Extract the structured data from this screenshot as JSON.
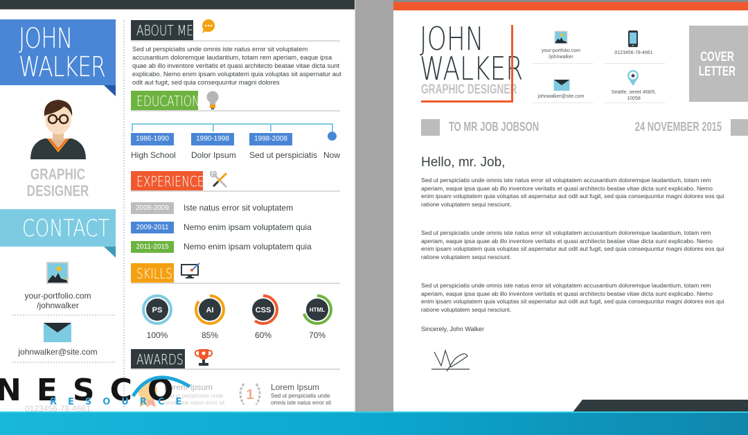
{
  "resume": {
    "name_line1": "JOHN",
    "name_line2": "WALKER",
    "role_line1": "GRAPHIC",
    "role_line2": "DESIGNER",
    "contact": {
      "title": "CONTACT",
      "portfolio_line1": "your-portfolio.com",
      "portfolio_line2": "/johnwalker",
      "email": "johnwalker@site.com",
      "phone": "0123456-78-4661"
    },
    "about": {
      "title": "ABOUT ME",
      "text": "Sed ut perspiciatis unde omnis iste natus error sit voluptatem accusantium doloremque laudantium, totam rem aperiam, eaque ipsa quae ab illo inventore veritatis et quasi architecto beatae vitae dicta sunt explicabo. Nemo enim ipsam voluptatem quia voluptas sit aspernatur aut odit aut fugit, sed quia consequuntur magni dolores"
    },
    "education": {
      "title": "EDUCATION",
      "items": [
        {
          "years": "1986-1990",
          "label": "High School"
        },
        {
          "years": "1990-1998",
          "label": "Dolor Ipsum"
        },
        {
          "years": "1998-2008",
          "label": "Sed ut perspiciatis"
        },
        {
          "years": "",
          "label": "Now"
        }
      ]
    },
    "experience": {
      "title": "EXPERIENCE",
      "items": [
        {
          "years": "2008-2009",
          "text": "Iste natus error sit voluptatem",
          "color": "#bdbdbd"
        },
        {
          "years": "2009-2011",
          "text": "Nemo enim ipsam voluptatem quia",
          "color": "#4a86d6"
        },
        {
          "years": "2011-2015",
          "text": "Nemo enim ipsam voluptatem quia",
          "color": "#6db33f"
        }
      ]
    },
    "skills": {
      "title": "SKILLS",
      "items": [
        {
          "name": "PS",
          "percent": 100,
          "pct_label": "100%",
          "color": "#7dcbe2"
        },
        {
          "name": "AI",
          "percent": 85,
          "pct_label": "85%",
          "color": "#f5a010"
        },
        {
          "name": "CSS",
          "percent": 60,
          "pct_label": "60%",
          "color": "#f0592e"
        },
        {
          "name": "HTML",
          "percent": 70,
          "pct_label": "70%",
          "color": "#6db33f"
        }
      ]
    },
    "awards": {
      "title": "AWARDS",
      "items": [
        {
          "title": "Lorem Ipsum",
          "line1": "Sed ut perspiciatis unde",
          "line2": "omnis iste natus error sit"
        },
        {
          "title": "Lorem Ipsum",
          "line1": "Sed ut perspiciatis unde",
          "line2": "omnis iste natus error sit",
          "badge": "1"
        }
      ]
    },
    "colors": {
      "blue": "#4a86d6",
      "teal": "#7dcbe2",
      "green": "#6db33f",
      "orange": "#f0592e",
      "amber": "#f5a010",
      "dark": "#303a3e"
    }
  },
  "letter": {
    "name_line1": "JOHN",
    "name_line2": "WALKER",
    "role": "GRAPHIC DESIGNER",
    "contact": {
      "portfolio_line1": "your-portfolio.com",
      "portfolio_line2": "/johnwalker",
      "phone": "0123456-78-4661",
      "email": "johnwalker@site.com",
      "address_line1": "Seattle, street 468/5,",
      "address_line2": "10058"
    },
    "cover_line1": "COVER",
    "cover_line2": "LETTER",
    "recipient": "TO MR JOB JOBSON",
    "date": "24 NOVEMBER 2015",
    "greeting": "Hello, mr. Job,",
    "paragraphs": [
      "Sed ut perspiciatis unde omnis iste natus error sit voluptatem accusantium doloremque laudantium, totam rem aperiam, eaque ipsa quae ab illo inventore veritatis et quasi architecto beatae vitae dicta sunt explicabo. Nemo enim ipsam voluptatem quia voluptas sit aspernatur aut odit aut fugit, sed quia consequuntur magni dolores eos qui ratione voluptatem sequi nesciunt.",
      "Sed ut perspiciatis unde omnis iste natus error sit voluptatem accusantium doloremque laudantium, totam rem aperiam, eaque ipsa quae ab illo inventore veritatis et quasi architecto beatae vitae dicta sunt explicabo. Nemo enim ipsam voluptatem quia voluptas sit aspernatur aut odit aut fugit, sed quia consequuntur magni dolores eos qui ratione voluptatem sequi nesciunt.",
      "Sed ut perspiciatis unde omnis iste natus error sit voluptatem accusantium doloremque laudantium, totam rem aperiam, eaque ipsa quae ab illo inventore veritatis et quasi architecto beatae vitae dicta sunt explicabo. Nemo enim ipsam voluptatem quia voluptas sit aspernatur aut odit aut fugit, sed quia consequuntur magni dolores eos qui ratione voluptatem sequi nesciunt."
    ],
    "closing": "Sincerely, John Walker"
  },
  "logo": {
    "word": "NESCO",
    "sub": "RESOURCE"
  }
}
